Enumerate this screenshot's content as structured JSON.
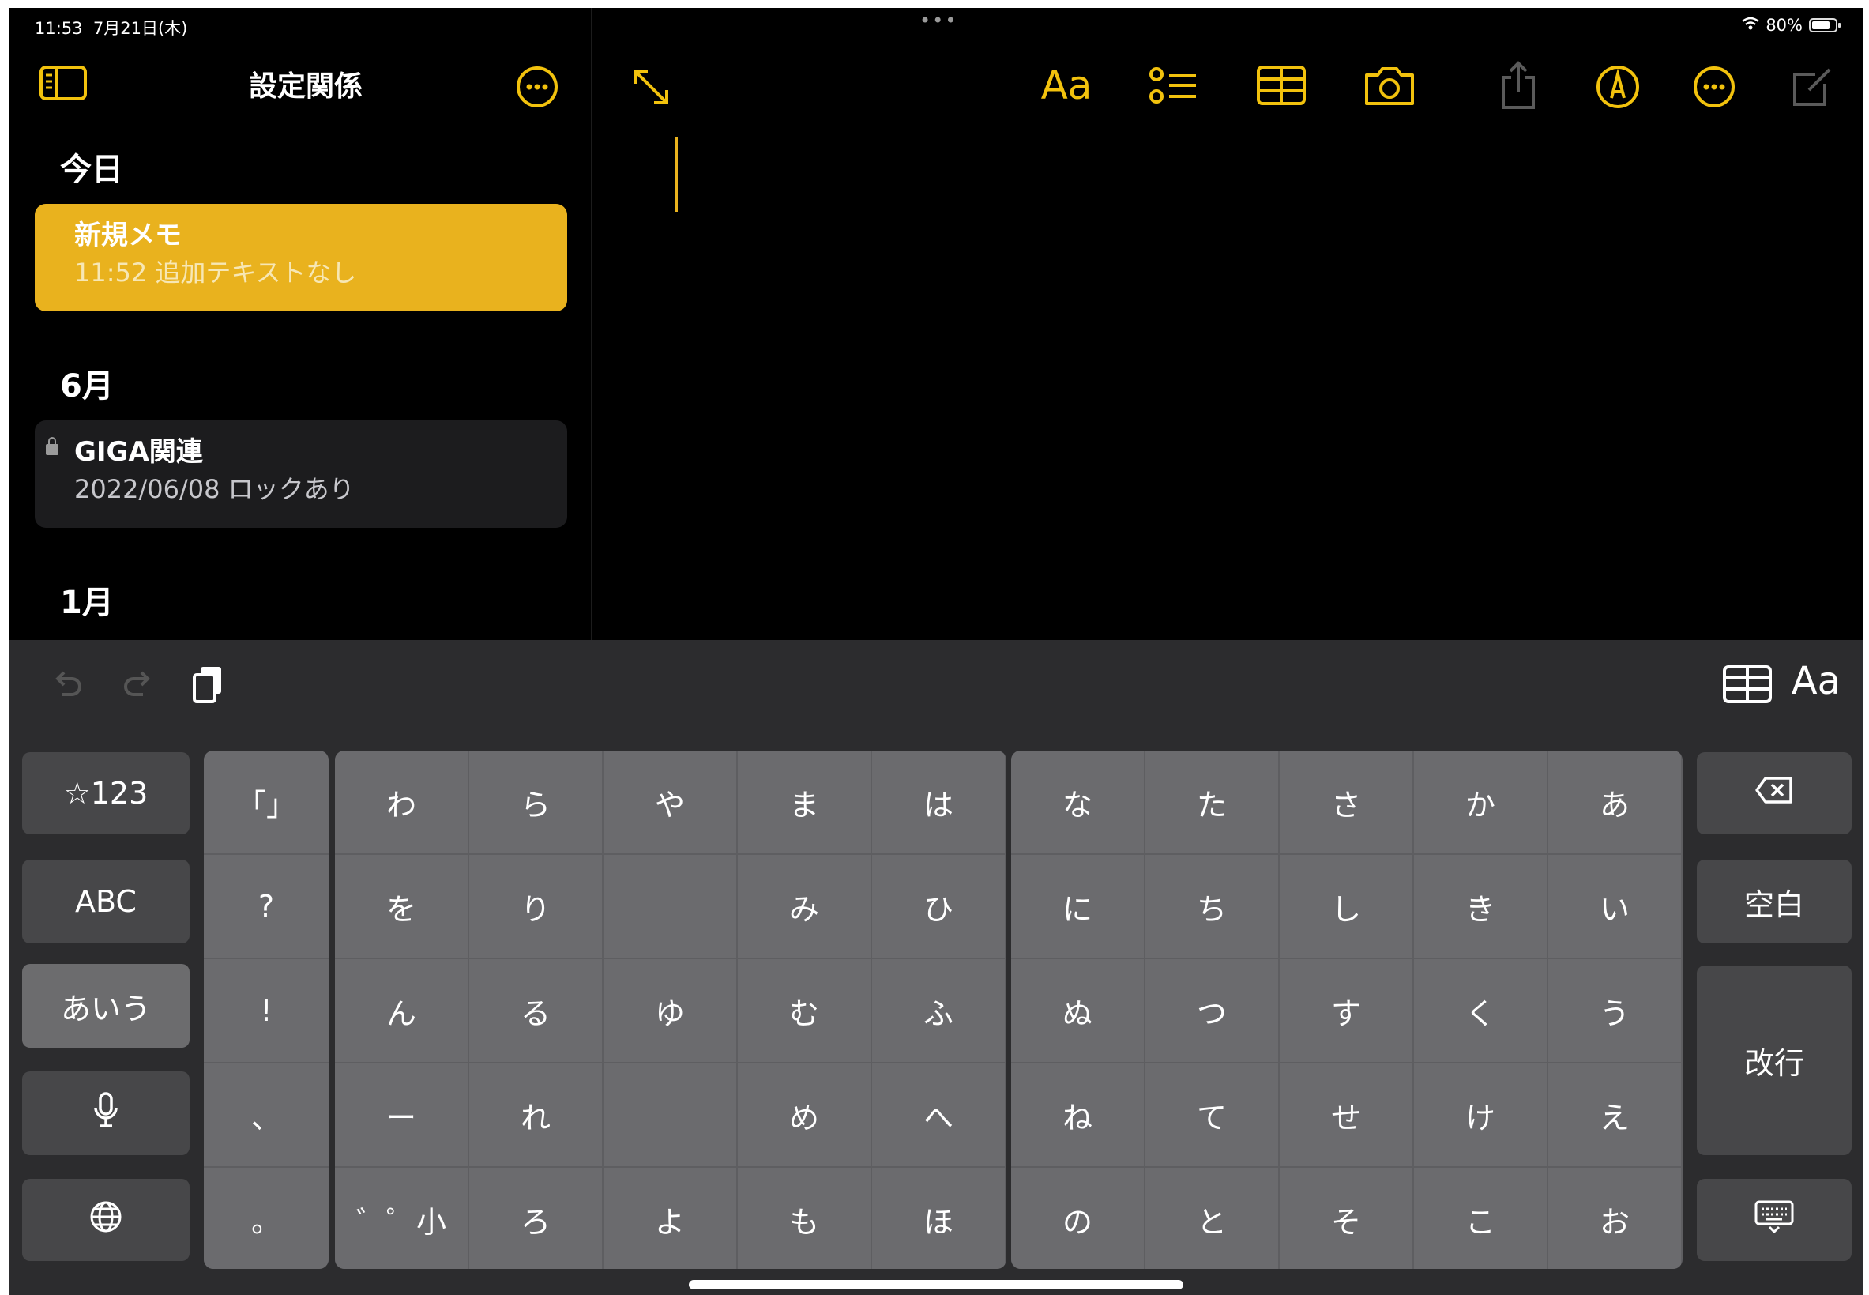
{
  "status_bar": {
    "time": "11:53",
    "date": "7月21日(木)",
    "multitask_dots": "•••",
    "battery_percent": "80%"
  },
  "sidebar": {
    "title": "設定関係",
    "sections": [
      {
        "header": "今日",
        "notes": [
          {
            "title": "新規メモ",
            "subtitle": "11:52  追加テキストなし",
            "selected": true
          }
        ]
      },
      {
        "header": "6月",
        "notes": [
          {
            "title": "GIGA関連",
            "subtitle": "2022/06/08  ロックあり",
            "locked": true
          }
        ]
      },
      {
        "header": "1月",
        "notes": []
      }
    ]
  },
  "toolbar": {
    "format_label": "Aa"
  },
  "keyboard": {
    "toolbar": {
      "format_label": "Aa"
    },
    "left_keys": [
      "☆123",
      "ABC",
      "あいう"
    ],
    "right_keys": {
      "space": "空白",
      "return": "改行"
    },
    "punct_keys": [
      "「」",
      "?",
      "!",
      "、",
      "。"
    ],
    "block1": [
      [
        "わ",
        "ら",
        "や",
        "ま",
        "は"
      ],
      [
        "を",
        "り",
        "",
        "み",
        "ひ"
      ],
      [
        "ん",
        "る",
        "ゆ",
        "む",
        "ふ"
      ],
      [
        "ー",
        "れ",
        "",
        "め",
        "へ"
      ],
      [
        "゛゜小",
        "ろ",
        "よ",
        "も",
        "ほ"
      ]
    ],
    "block2": [
      [
        "な",
        "た",
        "さ",
        "か",
        "あ"
      ],
      [
        "に",
        "ち",
        "し",
        "き",
        "い"
      ],
      [
        "ぬ",
        "つ",
        "す",
        "く",
        "う"
      ],
      [
        "ね",
        "て",
        "せ",
        "け",
        "え"
      ],
      [
        "の",
        "と",
        "そ",
        "こ",
        "お"
      ]
    ]
  },
  "colors": {
    "accent": "#e9b21e",
    "background": "#000000",
    "keyboard": "#2c2c2e"
  }
}
